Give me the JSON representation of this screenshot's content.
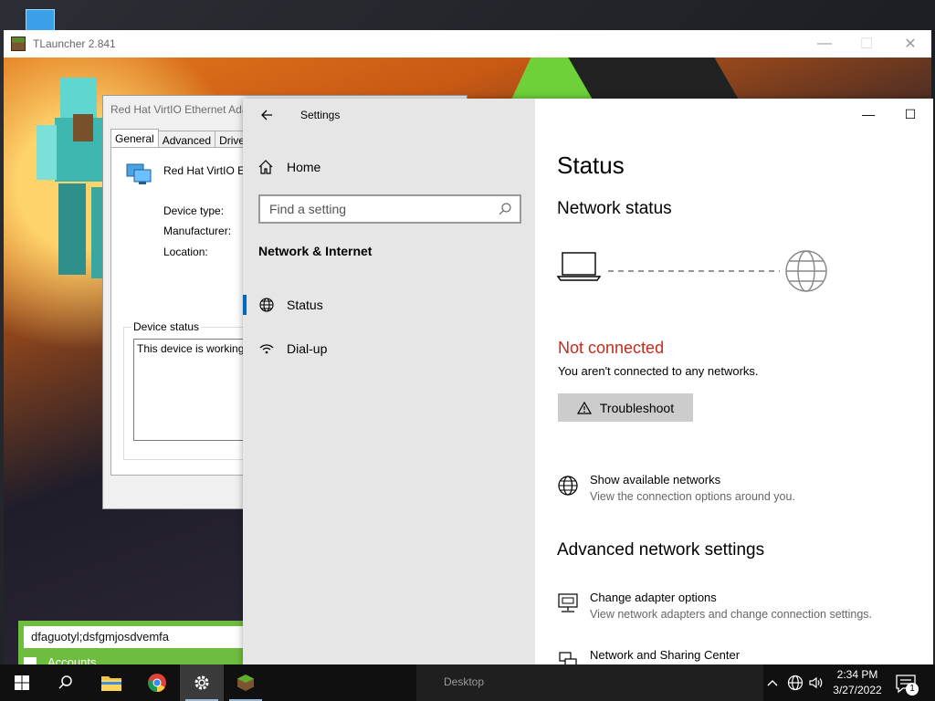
{
  "tlauncher": {
    "title": "TLauncher 2.841",
    "controls": {
      "minimize": "—",
      "maximize": "☐",
      "close": "✕"
    },
    "username": "dfaguotyl;dsfgmjosdvemfa",
    "accounts_label": "Accounts"
  },
  "device_dialog": {
    "title": "Red Hat VirtIO Ethernet Ada",
    "tabs": [
      "General",
      "Advanced",
      "Driver"
    ],
    "device_name": "Red Hat VirtIO Ethe",
    "labels": {
      "device_type": "Device type:",
      "manufacturer": "Manufacturer:",
      "location": "Location:"
    },
    "status_group_label": "Device status",
    "status_text": "This device is working pro"
  },
  "settings": {
    "app_title": "Settings",
    "back_icon": "arrow-left-icon",
    "home_label": "Home",
    "search_placeholder": "Find a setting",
    "section_title": "Network & Internet",
    "nav_items": [
      {
        "label": "Status",
        "icon": "globe-icon",
        "selected": true
      },
      {
        "label": "Dial-up",
        "icon": "dialup-icon",
        "selected": false
      }
    ],
    "window_controls": {
      "minimize": "—",
      "maximize": "☐"
    },
    "page_title": "Status",
    "network_status_heading": "Network status",
    "connection_state": "Not connected",
    "connection_desc": "You aren't connected to any networks.",
    "troubleshoot_label": "Troubleshoot",
    "show_networks": {
      "title": "Show available networks",
      "subtitle": "View the connection options around you."
    },
    "advanced_heading": "Advanced network settings",
    "change_adapter": {
      "title": "Change adapter options",
      "subtitle": "View network adapters and change connection settings."
    },
    "sharing_center": {
      "title": "Network and Sharing Center"
    }
  },
  "taskbar": {
    "preview_text": "Desktop",
    "time": "2:34 PM",
    "date": "3/27/2022",
    "notification_count": "1"
  },
  "colors": {
    "error": "#c42b1c",
    "accent": "#0067c0",
    "launcher_green": "#6fbd3f"
  }
}
